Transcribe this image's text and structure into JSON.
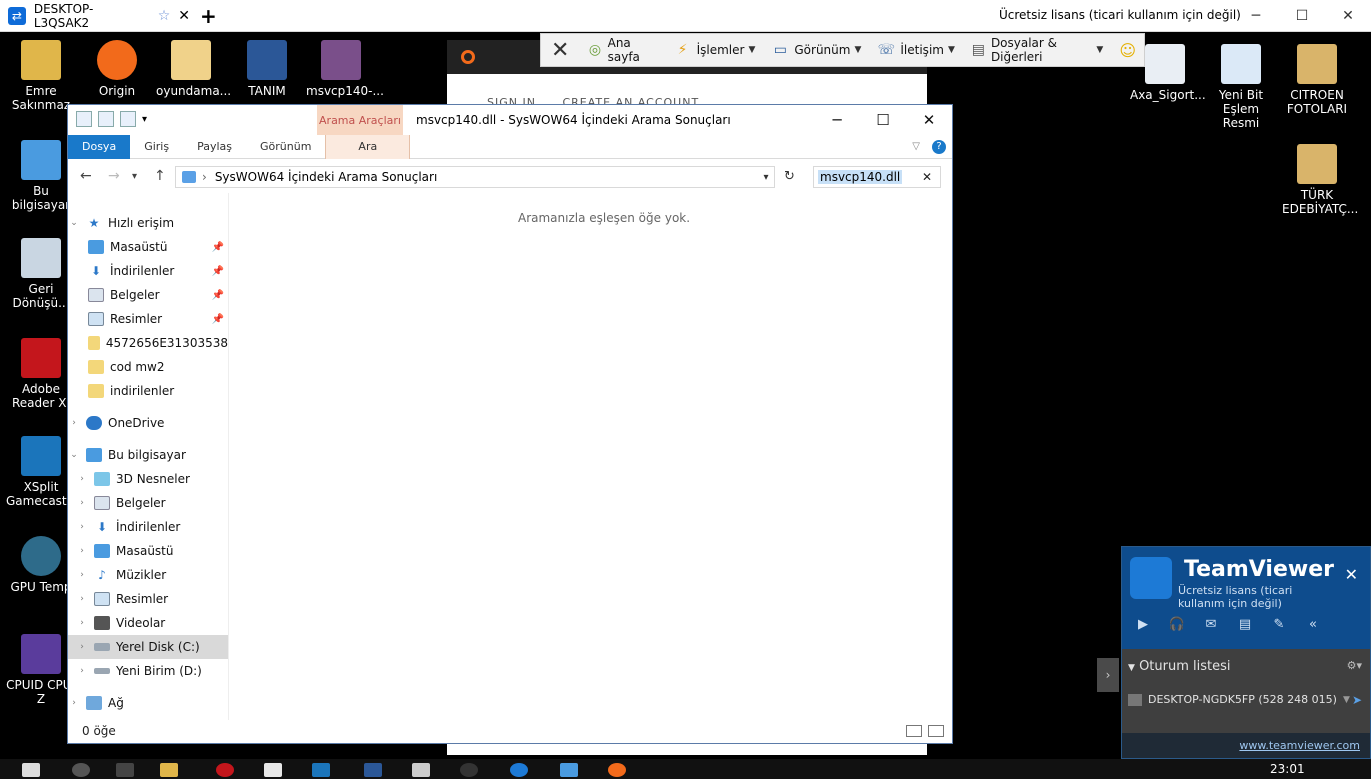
{
  "tv_top": {
    "tab_name": "DESKTOP-L3QSAK2",
    "license_text": "Ücretsiz lisans (ticari kullanım için değil)"
  },
  "tv_toolbar": {
    "home": "Ana sayfa",
    "actions": "İşlemler",
    "view": "Görünüm",
    "communicate": "İletişim",
    "files": "Dosyalar & Diğerleri"
  },
  "desktop": {
    "icons": [
      {
        "label": "Emre Sakınmaz"
      },
      {
        "label": "Origin"
      },
      {
        "label": "oyundama..."
      },
      {
        "label": "TANIM"
      },
      {
        "label": "msvcp140-..."
      },
      {
        "label": "Bu bilgisayar"
      },
      {
        "label": "Geri Dönüşü..."
      },
      {
        "label": "Adobe Reader XI"
      },
      {
        "label": "XSplit Gamecaster"
      },
      {
        "label": "GPU Temp"
      },
      {
        "label": "CPUID CPU-Z"
      },
      {
        "label": "Axa_Sigort..."
      },
      {
        "label": "Yeni Bit Eşlem Resmi"
      },
      {
        "label": "CITROEN FOTOLARI"
      },
      {
        "label": "TÜRK EDEBİYATÇ..."
      }
    ]
  },
  "origin": {
    "sign_in": "SIGN IN",
    "create_account": "CREATE AN ACCOUNT"
  },
  "explorer": {
    "context_group": "Arama Araçları",
    "title": "msvcp140.dll - SysWOW64 İçindeki Arama Sonuçları",
    "ribbon_tabs": [
      "Dosya",
      "Giriş",
      "Paylaş",
      "Görünüm",
      "Ara"
    ],
    "address": "SysWOW64 İçindeki Arama Sonuçları",
    "search_value": "msvcp140.dll",
    "empty_message": "Aramanızla eşleşen öğe yok.",
    "status": "0 öğe",
    "nav": [
      {
        "label": "Hızlı erişim"
      },
      {
        "label": "Masaüstü"
      },
      {
        "label": "İndirilenler"
      },
      {
        "label": "Belgeler"
      },
      {
        "label": "Resimler"
      },
      {
        "label": "4572656E31303538"
      },
      {
        "label": "cod mw2"
      },
      {
        "label": "indirilenler"
      },
      {
        "label": "OneDrive"
      },
      {
        "label": "Bu bilgisayar"
      },
      {
        "label": "3D Nesneler"
      },
      {
        "label": "Belgeler"
      },
      {
        "label": "İndirilenler"
      },
      {
        "label": "Masaüstü"
      },
      {
        "label": "Müzikler"
      },
      {
        "label": "Resimler"
      },
      {
        "label": "Videolar"
      },
      {
        "label": "Yerel Disk (C:)"
      },
      {
        "label": "Yeni Birim (D:)"
      },
      {
        "label": "Ağ"
      }
    ]
  },
  "tvpanel": {
    "title": "TeamViewer",
    "subtitle": "Ücretsiz lisans (ticari kullanım için değil)",
    "list_header": "Oturum listesi",
    "session": "DESKTOP-NGDK5FP (528 248 015)",
    "link": "www.teamviewer.com"
  },
  "clock": "23:01"
}
